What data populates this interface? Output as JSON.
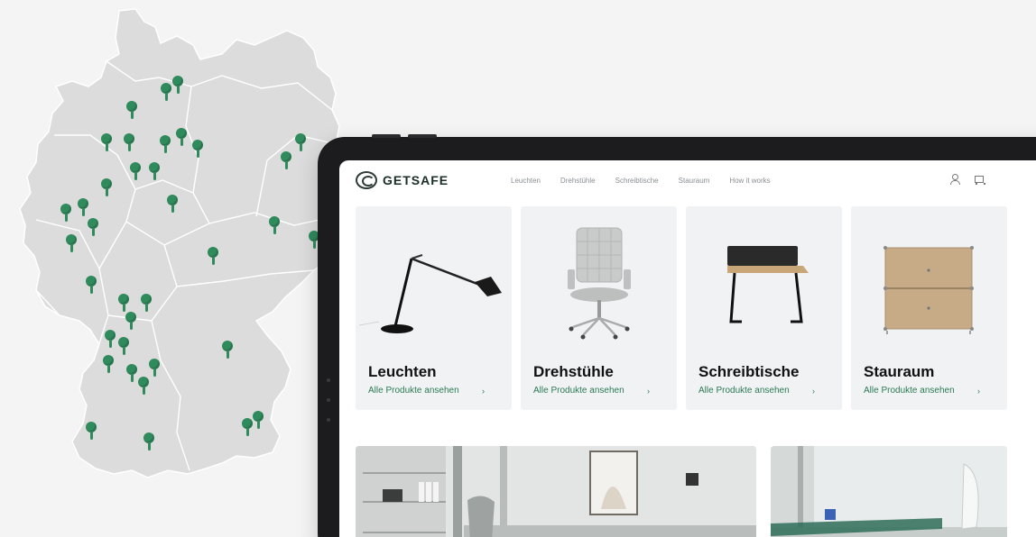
{
  "brand": {
    "name": "GETSAFE",
    "accent_color": "#2b7b54",
    "pin_color": "#2f8a5c"
  },
  "nav": {
    "links": [
      "Leuchten",
      "Drehstühle",
      "Schreibtische",
      "Stauraum",
      "How it works"
    ],
    "icons": [
      "user-icon",
      "cart-icon"
    ]
  },
  "categories": [
    {
      "title": "Leuchten",
      "link": "Alle Produkte ansehen",
      "chevron": "›",
      "icon": "desk-lamp"
    },
    {
      "title": "Drehstühle",
      "link": "Alle Produkte ansehen",
      "chevron": "›",
      "icon": "office-chair"
    },
    {
      "title": "Schreibtische",
      "link": "Alle Produkte ansehen",
      "chevron": "›",
      "icon": "desk"
    },
    {
      "title": "Stauraum",
      "link": "Alle Produkte ansehen",
      "chevron": "›",
      "icon": "cabinet"
    }
  ],
  "map": {
    "region": "Germany",
    "pin_count": 44
  }
}
